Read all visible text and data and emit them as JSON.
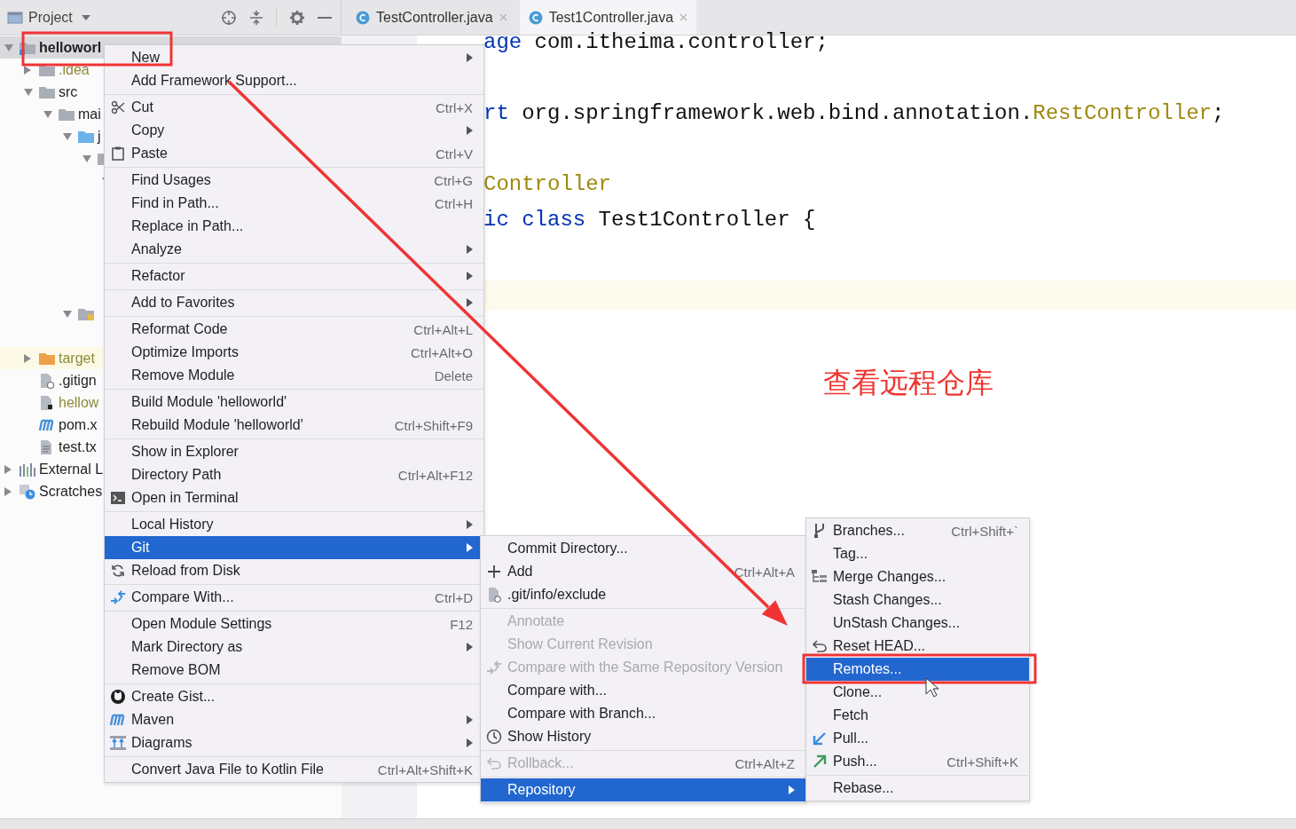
{
  "project_panel": {
    "title": "Project",
    "tree": [
      {
        "label": "helloworl",
        "kind": "module",
        "expanded": true,
        "selected": true,
        "ignored": false,
        "children": [
          {
            "label": ".idea",
            "kind": "folder",
            "expanded": false,
            "selected": false,
            "ignored": true
          },
          {
            "label": "src",
            "kind": "folder",
            "expanded": true,
            "selected": false,
            "ignored": false,
            "children": [
              {
                "label": "mai",
                "kind": "folder",
                "expanded": true,
                "selected": false,
                "ignored": false,
                "children": [
                  {
                    "label": "j",
                    "kind": "source_folder",
                    "expanded": true,
                    "selected": false,
                    "children": [
                      {
                        "kind": "folder",
                        "expanded": true,
                        "selected": false,
                        "children": [
                          {
                            "expanded": true,
                            "selected": false
                          }
                        ]
                      }
                    ]
                  },
                  {
                    "kind": "resources_folder",
                    "expanded": true,
                    "selected": false
                  }
                ]
              }
            ]
          },
          {
            "label": "target",
            "kind": "excluded_folder",
            "expanded": false,
            "selected": false,
            "ignored": true
          },
          {
            "label": ".gitign",
            "kind": "gitignore_file",
            "selected": false,
            "ignored": false
          },
          {
            "label": "hellow",
            "kind": "module_file",
            "selected": false,
            "ignored": true
          },
          {
            "label": "pom.x",
            "kind": "maven_file",
            "selected": false,
            "ignored": false
          },
          {
            "label": "test.tx",
            "kind": "text_file",
            "selected": false,
            "ignored": false
          }
        ]
      },
      {
        "label": "External L",
        "kind": "libraries",
        "expanded": false,
        "selected": false,
        "ignored": false
      },
      {
        "label": "Scratches",
        "kind": "scratches",
        "expanded": false,
        "selected": false,
        "ignored": false
      }
    ]
  },
  "editor_tabs": [
    {
      "label": "TestController.java",
      "selected": false
    },
    {
      "label": "Test1Controller.java",
      "selected": true
    }
  ],
  "editor": {
    "lines": [
      [
        {
          "text": "age",
          "kind": "keyword"
        },
        {
          "text": " com.itheima.controller;",
          "kind": "plain"
        }
      ],
      [
        {
          "text": "rt",
          "kind": "keyword"
        },
        {
          "text": " org.springframework.web.bind.annotation.",
          "kind": "plain"
        },
        {
          "text": "RestController",
          "kind": "annotation"
        },
        {
          "text": ";",
          "kind": "plain"
        }
      ],
      [
        {
          "text": "Controller",
          "kind": "annotation"
        }
      ],
      [
        {
          "text": "ic class",
          "kind": "keyword"
        },
        {
          "text": " Test1Controller {",
          "kind": "plain"
        }
      ]
    ]
  },
  "context_menu": {
    "groups": [
      [
        {
          "label": "New",
          "submenu": true,
          "selected": false
        },
        {
          "label": "Add Framework Support...",
          "submenu": false,
          "selected": false
        }
      ],
      [
        {
          "label": "Cut",
          "shortcut": "Ctrl+X",
          "submenu": false,
          "selected": false
        },
        {
          "label": "Copy",
          "submenu": true,
          "selected": false
        },
        {
          "label": "Paste",
          "shortcut": "Ctrl+V",
          "submenu": false,
          "selected": false
        }
      ],
      [
        {
          "label": "Find Usages",
          "shortcut": "Ctrl+G",
          "submenu": false,
          "selected": false
        },
        {
          "label": "Find in Path...",
          "shortcut": "Ctrl+H",
          "submenu": false,
          "selected": false
        },
        {
          "label": "Replace in Path...",
          "submenu": false,
          "selected": false
        },
        {
          "label": "Analyze",
          "submenu": true,
          "selected": false
        }
      ],
      [
        {
          "label": "Refactor",
          "submenu": true,
          "selected": false
        }
      ],
      [
        {
          "label": "Add to Favorites",
          "submenu": true,
          "selected": false
        }
      ],
      [
        {
          "label": "Reformat Code",
          "shortcut": "Ctrl+Alt+L",
          "submenu": false,
          "selected": false
        },
        {
          "label": "Optimize Imports",
          "shortcut": "Ctrl+Alt+O",
          "submenu": false,
          "selected": false
        },
        {
          "label": "Remove Module",
          "shortcut": "Delete",
          "submenu": false,
          "selected": false
        }
      ],
      [
        {
          "label": "Build Module 'helloworld'",
          "submenu": false,
          "selected": false
        },
        {
          "label": "Rebuild Module 'helloworld'",
          "shortcut": "Ctrl+Shift+F9",
          "submenu": false,
          "selected": false
        }
      ],
      [
        {
          "label": "Show in Explorer",
          "submenu": false,
          "selected": false
        },
        {
          "label": "Directory Path",
          "shortcut": "Ctrl+Alt+F12",
          "submenu": false,
          "selected": false
        },
        {
          "label": "Open in Terminal",
          "submenu": false,
          "selected": false
        }
      ],
      [
        {
          "label": "Local History",
          "submenu": true,
          "selected": false
        },
        {
          "label": "Git",
          "submenu": true,
          "selected": true
        },
        {
          "label": "Reload from Disk",
          "submenu": false,
          "selected": false
        }
      ],
      [
        {
          "label": "Compare With...",
          "shortcut": "Ctrl+D",
          "submenu": false,
          "selected": false
        }
      ],
      [
        {
          "label": "Open Module Settings",
          "shortcut": "F12",
          "submenu": false,
          "selected": false
        },
        {
          "label": "Mark Directory as",
          "submenu": true,
          "selected": false
        },
        {
          "label": "Remove BOM",
          "submenu": false,
          "selected": false
        }
      ],
      [
        {
          "label": "Create Gist...",
          "submenu": false,
          "selected": false
        },
        {
          "label": "Maven",
          "submenu": true,
          "selected": false
        },
        {
          "label": "Diagrams",
          "submenu": true,
          "selected": false
        }
      ],
      [
        {
          "label": "Convert Java File to Kotlin File",
          "shortcut": "Ctrl+Alt+Shift+K",
          "submenu": false,
          "selected": false
        }
      ]
    ]
  },
  "git_submenu": {
    "groups": [
      [
        {
          "label": "Commit Directory...",
          "submenu": false,
          "selected": false,
          "disabled": false
        },
        {
          "label": "Add",
          "shortcut": "Ctrl+Alt+A",
          "submenu": false,
          "selected": false,
          "disabled": false
        },
        {
          "label": ".git/info/exclude",
          "submenu": false,
          "selected": false,
          "disabled": false
        }
      ],
      [
        {
          "label": "Annotate",
          "submenu": false,
          "selected": false,
          "disabled": true
        },
        {
          "label": "Show Current Revision",
          "submenu": false,
          "selected": false,
          "disabled": true
        },
        {
          "label": "Compare with the Same Repository Version",
          "submenu": false,
          "selected": false,
          "disabled": true
        },
        {
          "label": "Compare with...",
          "submenu": false,
          "selected": false,
          "disabled": false
        },
        {
          "label": "Compare with Branch...",
          "submenu": false,
          "selected": false,
          "disabled": false
        },
        {
          "label": "Show History",
          "submenu": false,
          "selected": false,
          "disabled": false
        }
      ],
      [
        {
          "label": "Rollback...",
          "shortcut": "Ctrl+Alt+Z",
          "submenu": false,
          "selected": false,
          "disabled": true
        }
      ],
      [
        {
          "label": "Repository",
          "submenu": true,
          "selected": true,
          "disabled": false
        }
      ]
    ]
  },
  "repository_submenu": {
    "groups": [
      [
        {
          "label": "Branches...",
          "shortcut": "Ctrl+Shift+`",
          "submenu": false,
          "selected": false
        },
        {
          "label": "Tag...",
          "submenu": false,
          "selected": false
        },
        {
          "label": "Merge Changes...",
          "submenu": false,
          "selected": false
        },
        {
          "label": "Stash Changes...",
          "submenu": false,
          "selected": false
        },
        {
          "label": "UnStash Changes...",
          "submenu": false,
          "selected": false
        },
        {
          "label": "Reset HEAD...",
          "submenu": false,
          "selected": false
        },
        {
          "label": "Remotes...",
          "submenu": false,
          "selected": true
        },
        {
          "label": "Clone...",
          "submenu": false,
          "selected": false
        },
        {
          "label": "Fetch",
          "submenu": false,
          "selected": false
        },
        {
          "label": "Pull...",
          "submenu": false,
          "selected": false
        },
        {
          "label": "Push...",
          "shortcut": "Ctrl+Shift+K",
          "submenu": false,
          "selected": false
        }
      ],
      [
        {
          "label": "Rebase...",
          "submenu": false,
          "selected": false
        }
      ]
    ]
  },
  "annotation": {
    "text": "查看远程仓库"
  }
}
